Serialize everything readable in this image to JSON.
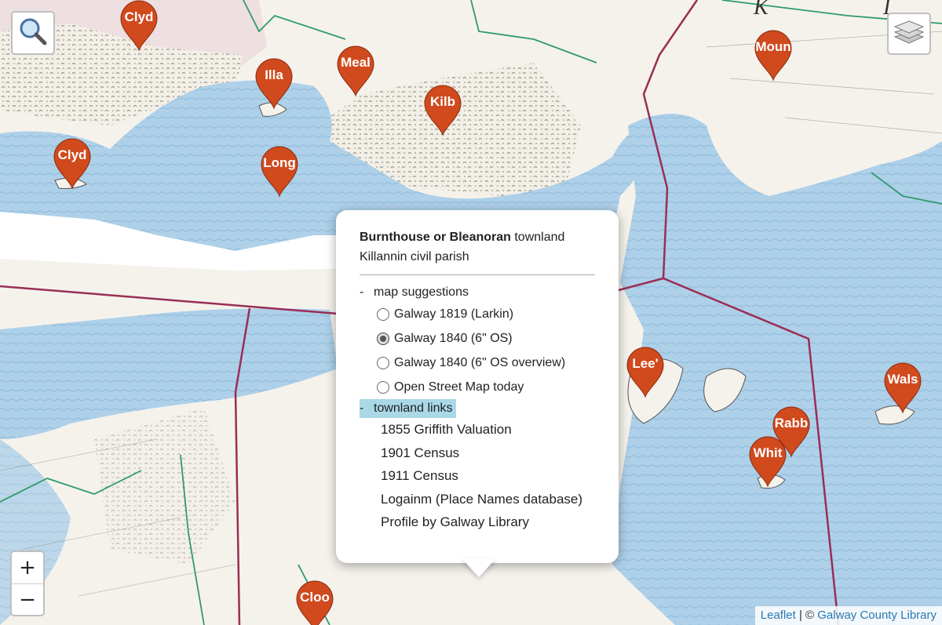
{
  "markers": [
    {
      "id": "m1",
      "label": "Clyd"
    },
    {
      "id": "m2",
      "label": "Illa"
    },
    {
      "id": "m3",
      "label": "Meal"
    },
    {
      "id": "m4",
      "label": "Kilb"
    },
    {
      "id": "m5",
      "label": "Clyd"
    },
    {
      "id": "m6",
      "label": "Long"
    },
    {
      "id": "m7",
      "label": "Moun"
    },
    {
      "id": "m8",
      "label": "Lee'"
    },
    {
      "id": "m9",
      "label": "Wals"
    },
    {
      "id": "m10",
      "label": "Rabb"
    },
    {
      "id": "m11",
      "label": "Whit"
    },
    {
      "id": "m12",
      "label": "Cloo"
    }
  ],
  "marker_color": "#d04a1e",
  "map_letters": [
    "K",
    "I"
  ],
  "popup": {
    "townland_name": "Burnthouse or Bleanoran",
    "townland_suffix": "townland",
    "parish": "Killannin civil parish",
    "map_section": {
      "dash": "-",
      "label": "map suggestions"
    },
    "map_options": [
      {
        "label": "Galway 1819 (Larkin)",
        "selected": false
      },
      {
        "label": "Galway 1840 (6\" OS)",
        "selected": true
      },
      {
        "label": "Galway 1840 (6\" OS overview)",
        "selected": false
      },
      {
        "label": "Open Street Map today",
        "selected": false
      }
    ],
    "links_section": {
      "dash": "-",
      "label": "townland links"
    },
    "links": [
      "1855 Griffith Valuation",
      "1901 Census",
      "1911 Census",
      "Logainm (Place Names database)",
      "Profile by Galway Library"
    ]
  },
  "zoom": {
    "in": "+",
    "out": "−"
  },
  "attribution": {
    "leaflet": "Leaflet",
    "sep": " | © ",
    "library": "Galway County Library"
  },
  "icons": {
    "search": "search-icon",
    "layers": "layers-icon"
  }
}
